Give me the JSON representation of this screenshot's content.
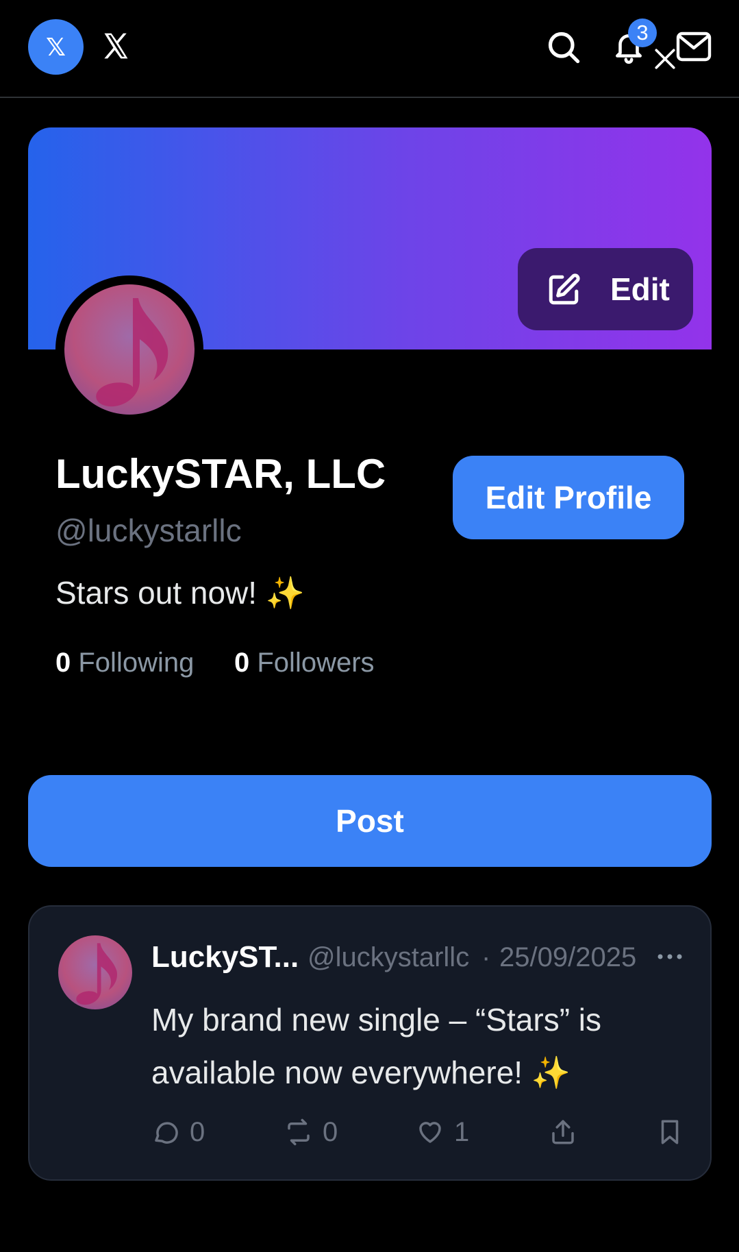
{
  "topbar": {
    "avatar_letter": "𝕏",
    "notifications_count": "3",
    "icons": [
      "x-logo-icon",
      "search-icon",
      "bell-icon",
      "close-icon",
      "mail-icon"
    ]
  },
  "banner": {
    "edit_label": "Edit"
  },
  "profile": {
    "name": "LuckySTAR, LLC",
    "handle": "@luckystarllc",
    "bio": "Stars out now! ✨",
    "following_count": "0",
    "following_label": "Following",
    "followers_count": "0",
    "followers_label": "Followers",
    "edit_profile_label": "Edit Profile"
  },
  "post_button_label": "Post",
  "post": {
    "author": "LuckyST...",
    "handle": "@luckystarllc",
    "separator": "·",
    "date": "25/09/2025",
    "text": "My brand new single – “Stars” is available now everywhere! ✨",
    "replies": "0",
    "reposts": "0",
    "likes": "1"
  },
  "colors": {
    "accent": "#3b82f6",
    "background": "#000000",
    "card": "#141a26",
    "muted": "#6b7280"
  }
}
